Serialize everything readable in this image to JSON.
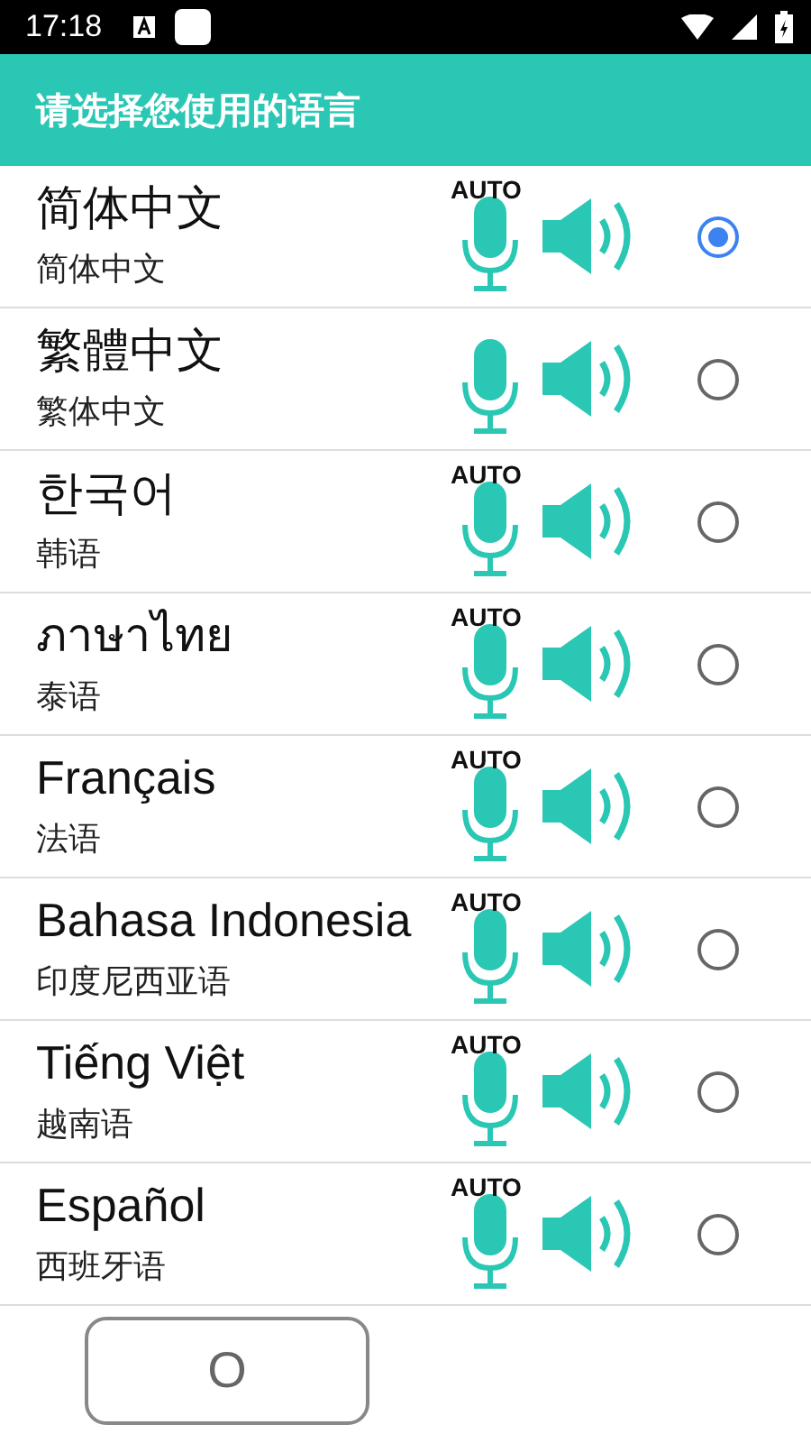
{
  "status_bar": {
    "time": "17:18"
  },
  "header": {
    "title": "请选择您使用的语言"
  },
  "languages": [
    {
      "name": "简体中文",
      "subtitle": "简体中文",
      "auto": "AUTO",
      "selected": true
    },
    {
      "name": "繁體中文",
      "subtitle": "繁体中文",
      "selected": false
    },
    {
      "name": "한국어",
      "subtitle": "韩语",
      "auto": "AUTO",
      "selected": false
    },
    {
      "name": "ภาษาไทย",
      "subtitle": "泰语",
      "auto": "AUTO",
      "selected": false
    },
    {
      "name": "Français",
      "subtitle": "法语",
      "auto": "AUTO",
      "selected": false
    },
    {
      "name": "Bahasa Indonesia",
      "subtitle": "印度尼西亚语",
      "auto": "AUTO",
      "selected": false
    },
    {
      "name": "Tiếng Việt",
      "subtitle": "越南语",
      "auto": "AUTO",
      "selected": false
    },
    {
      "name": "Español",
      "subtitle": "西班牙语",
      "auto": "AUTO",
      "selected": false
    }
  ],
  "button": {
    "label": "O"
  }
}
